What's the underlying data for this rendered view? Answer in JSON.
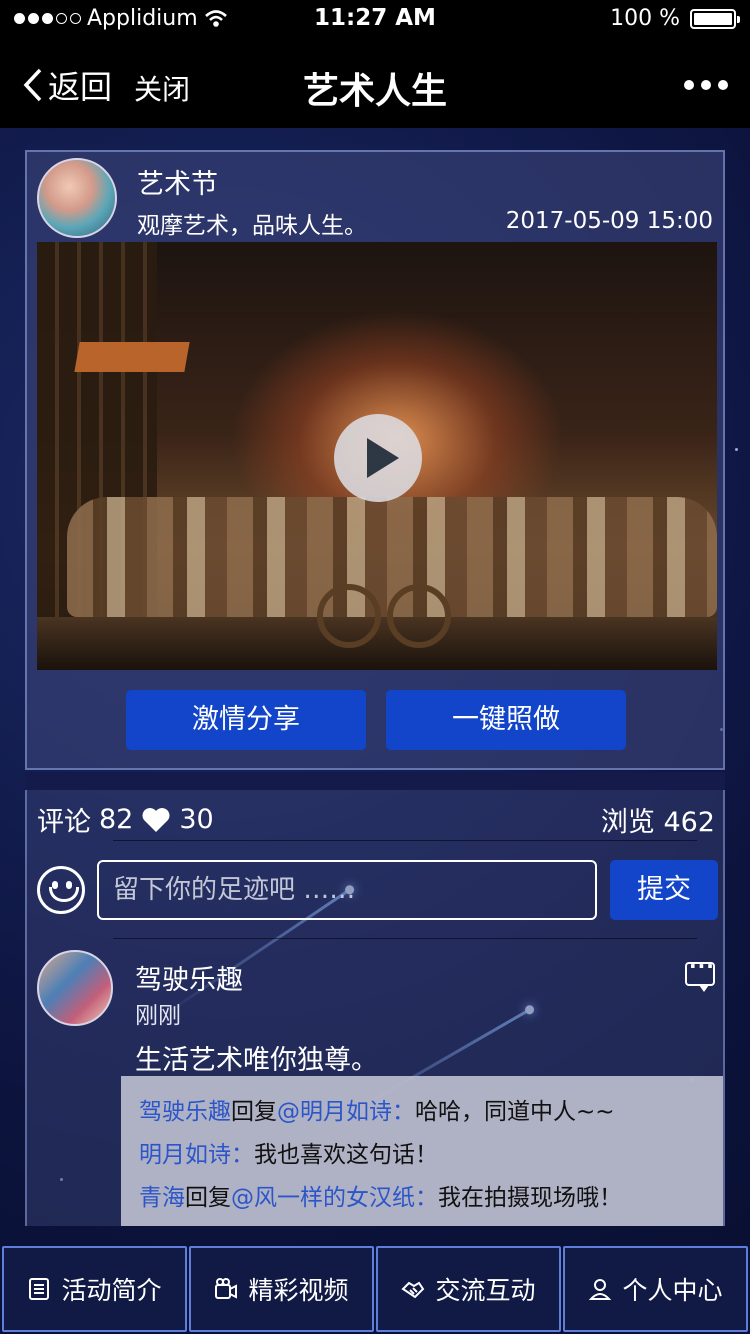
{
  "status_bar": {
    "carrier": "Applidium",
    "time": "11:27 AM",
    "battery": "100 %"
  },
  "nav": {
    "back_label": "返回",
    "close_label": "关闭",
    "title": "艺术人生"
  },
  "post": {
    "author": "艺术节",
    "motto": "观摩艺术，品味人生。",
    "date": "2017-05-09 15:00",
    "buttons": {
      "share": "激情分享",
      "do": "一键照做"
    }
  },
  "stats": {
    "comments_label": "评论",
    "comments_count": "82",
    "likes_count": "30",
    "views_label": "浏览",
    "views_count": "462"
  },
  "comment_box": {
    "placeholder": "留下你的足迹吧 ……",
    "submit_label": "提交"
  },
  "comments": [
    {
      "name": "驾驶乐趣",
      "time": "刚刚",
      "text": "生活艺术唯你独尊。",
      "replies": [
        {
          "from": "驾驶乐趣",
          "verb": "回复",
          "to": "@明月如诗：",
          "text": "哈哈，同道中人~~"
        },
        {
          "from": "明月如诗：",
          "verb": "",
          "to": "",
          "text": "我也喜欢这句话！"
        },
        {
          "from": "青海",
          "verb": "回复",
          "to": "@风一样的女汉纸：",
          "text": "我在拍摄现场哦！"
        }
      ]
    }
  ],
  "tabs": [
    {
      "label": "活动简介",
      "icon": "list-icon"
    },
    {
      "label": "精彩视频",
      "icon": "video-camera-icon"
    },
    {
      "label": "交流互动",
      "icon": "handshake-icon"
    },
    {
      "label": "个人中心",
      "icon": "person-icon"
    }
  ]
}
